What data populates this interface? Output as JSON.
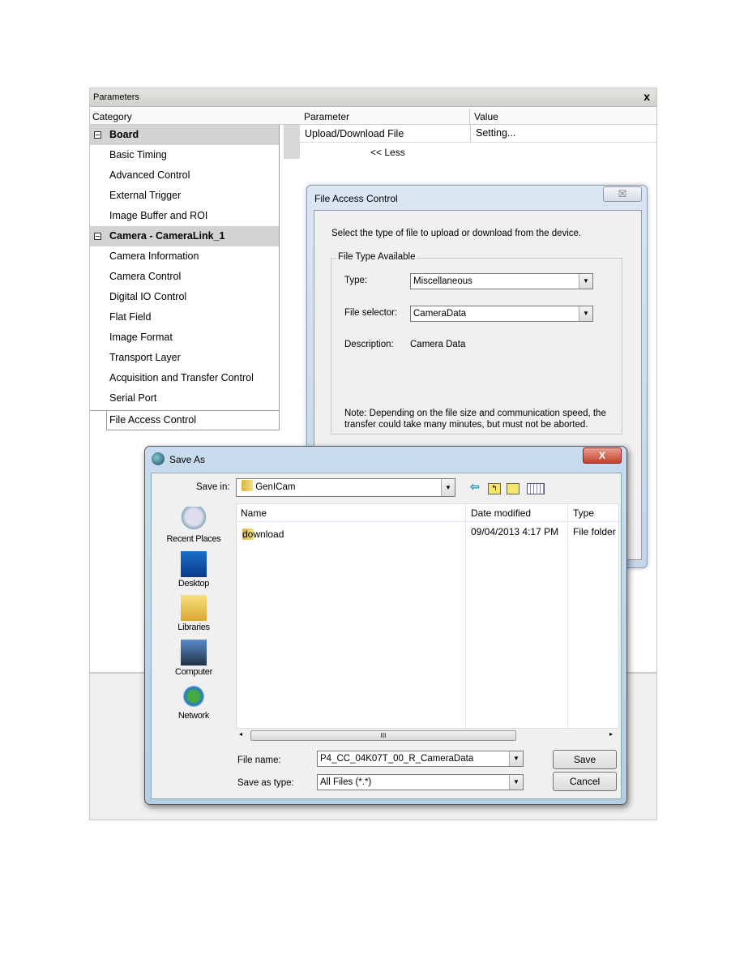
{
  "parameters": {
    "title": "Parameters",
    "close": "x",
    "col_category": "Category",
    "col_parameter": "Parameter",
    "col_value": "Value",
    "tree": [
      {
        "label": "Board",
        "group": true
      },
      {
        "label": "Basic Timing"
      },
      {
        "label": "Advanced Control"
      },
      {
        "label": "External Trigger"
      },
      {
        "label": "Image Buffer and ROI"
      },
      {
        "label": "Camera - CameraLink_1",
        "group": true
      },
      {
        "label": "Camera Information"
      },
      {
        "label": "Camera Control"
      },
      {
        "label": "Digital IO Control"
      },
      {
        "label": "Flat Field"
      },
      {
        "label": "Image Format"
      },
      {
        "label": "Transport Layer"
      },
      {
        "label": "Acquisition and Transfer Control"
      },
      {
        "label": "Serial Port"
      }
    ],
    "selected": "File Access Control",
    "row": {
      "parameter": "Upload/Download File",
      "value": "Setting..."
    },
    "less": "<< Less"
  },
  "file_access": {
    "title": "File Access Control",
    "close": "☒",
    "instruction": "Select the type of file to upload or download from the device.",
    "group": "File Type Available",
    "type_label": "Type:",
    "type_value": "Miscellaneous",
    "selector_label": "File selector:",
    "selector_value": "CameraData",
    "desc_label": "Description:",
    "desc_value": "Camera Data",
    "note": "Note: Depending on the file size and communication speed, the transfer could take many minutes, but must not be aborted."
  },
  "save_as": {
    "title": "Save As",
    "close": "X",
    "save_in_label": "Save in:",
    "save_in_value": "GenICam",
    "places": [
      "Recent Places",
      "Desktop",
      "Libraries",
      "Computer",
      "Network"
    ],
    "columns": [
      "Name",
      "Date modified",
      "Type"
    ],
    "files": [
      {
        "name": "download",
        "date": "09/04/2013 4:17 PM",
        "type": "File folder"
      }
    ],
    "scroll_grip": "III",
    "file_name_label": "File name:",
    "file_name_value": "P4_CC_04K07T_00_R_CameraData",
    "type_label": "Save as type:",
    "type_value": "All Files (*.*)",
    "save": "Save",
    "cancel": "Cancel"
  }
}
